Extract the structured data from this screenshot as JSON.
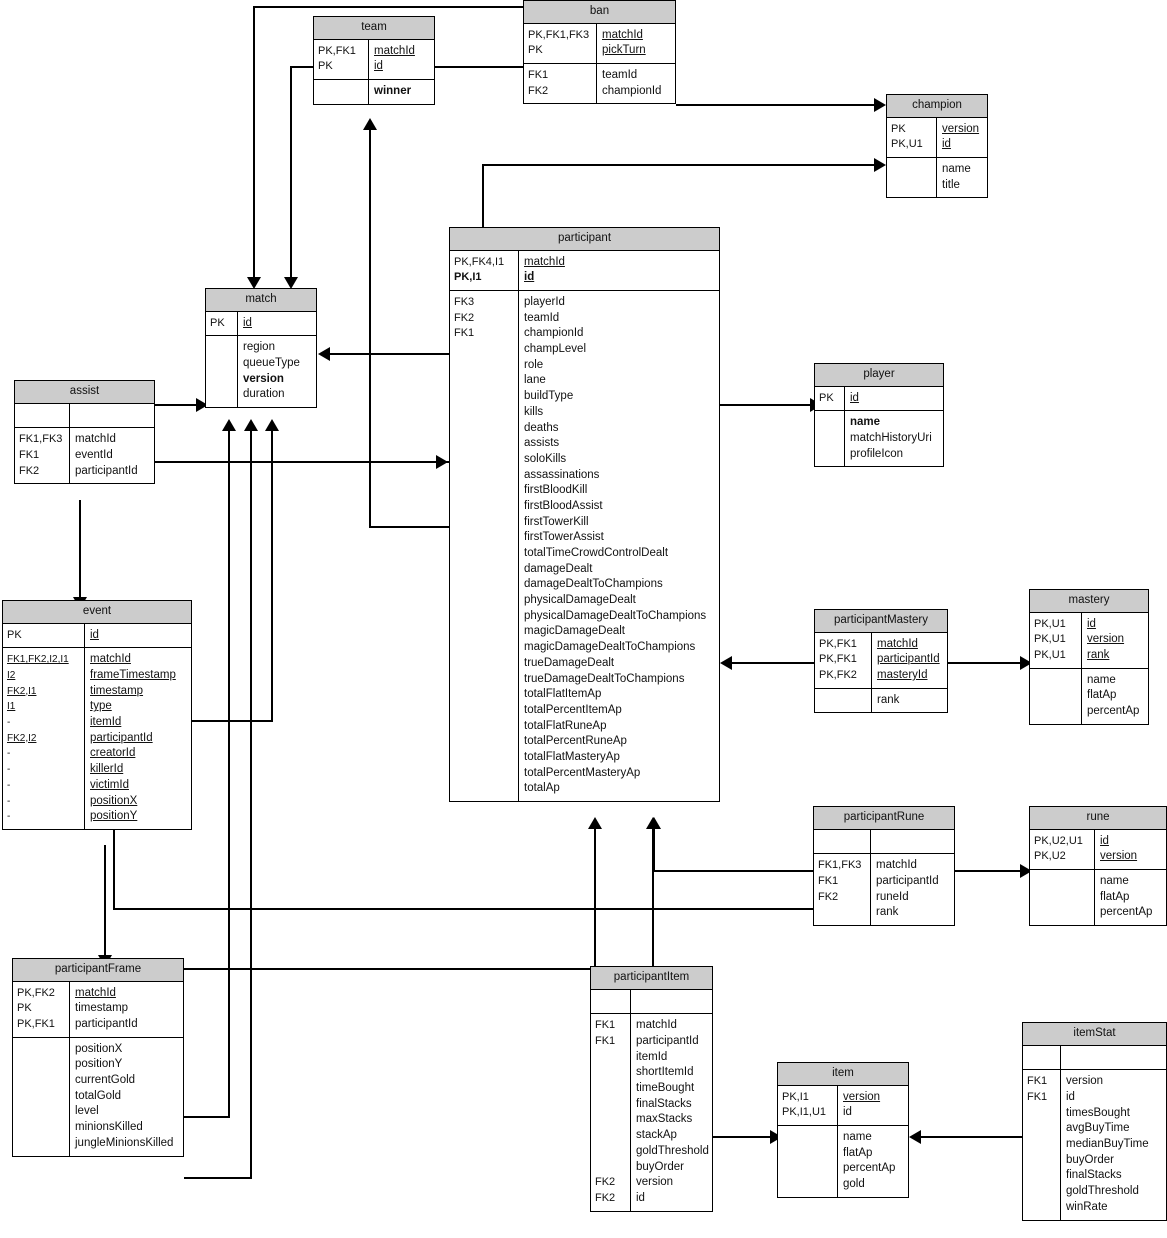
{
  "diagram": {
    "title": "League of Legends match database ER diagram",
    "header_fill": "#cccccc",
    "line_color": "#000000",
    "background": "#ffffff"
  },
  "entities": {
    "team": {
      "name": "team",
      "pk": {
        "keys": [
          "PK,FK1",
          "PK"
        ],
        "attrs": [
          "matchId",
          "id"
        ],
        "underline": [
          true,
          true
        ],
        "bold": [
          false,
          false
        ]
      },
      "attrs": {
        "keys": [
          ""
        ],
        "attrs": [
          "winner"
        ],
        "underline": [
          false
        ],
        "bold": [
          true
        ]
      }
    },
    "ban": {
      "name": "ban",
      "pk": {
        "keys": [
          "PK,FK1,FK3",
          "PK"
        ],
        "attrs": [
          "matchId",
          "pickTurn"
        ],
        "underline": [
          true,
          true
        ],
        "bold": [
          false,
          false
        ]
      },
      "attrs": {
        "keys": [
          "FK1",
          "FK2"
        ],
        "attrs": [
          "teamId",
          "championId"
        ],
        "underline": [
          false,
          false
        ],
        "bold": [
          false,
          false
        ]
      }
    },
    "champion": {
      "name": "champion",
      "pk": {
        "keys": [
          "PK",
          "PK,U1"
        ],
        "attrs": [
          "version",
          "id"
        ],
        "underline": [
          true,
          true
        ],
        "bold": [
          false,
          false
        ]
      },
      "attrs": {
        "keys": [
          "",
          ""
        ],
        "attrs": [
          "name",
          "title"
        ],
        "underline": [
          false,
          false
        ],
        "bold": [
          false,
          false
        ]
      }
    },
    "match": {
      "name": "match",
      "pk": {
        "keys": [
          "PK"
        ],
        "attrs": [
          "id"
        ],
        "underline": [
          true
        ],
        "bold": [
          false
        ]
      },
      "attrs": {
        "keys": [
          "",
          "",
          "",
          ""
        ],
        "attrs": [
          "region",
          "queueType",
          "version",
          "duration"
        ],
        "underline": [
          false,
          false,
          false,
          false
        ],
        "bold": [
          false,
          false,
          true,
          false
        ]
      }
    },
    "participant": {
      "name": "participant",
      "pk": {
        "keys": [
          "PK,FK4,I1",
          "PK,I1"
        ],
        "attrs": [
          "matchId",
          "id"
        ],
        "underline": [
          true,
          true
        ],
        "bold": [
          false,
          true
        ]
      },
      "attrs": {
        "keys": [
          "FK3",
          "FK2",
          "FK1",
          "",
          "",
          "",
          "",
          "",
          "",
          "",
          "",
          "",
          "",
          "",
          "",
          "",
          "",
          "",
          "",
          "",
          "",
          "",
          "",
          "",
          "",
          "",
          "",
          "",
          "",
          "",
          "",
          ""
        ],
        "attrs": [
          "playerId",
          "teamId",
          "championId",
          "champLevel",
          "role",
          "lane",
          "buildType",
          "kills",
          "deaths",
          "assists",
          "soloKills",
          "assassinations",
          "firstBloodKill",
          "firstBloodAssist",
          "firstTowerKill",
          "firstTowerAssist",
          "totalTimeCrowdControlDealt",
          "damageDealt",
          "damageDealtToChampions",
          "physicalDamageDealt",
          "physicalDamageDealtToChampions",
          "magicDamageDealt",
          "magicDamageDealtToChampions",
          "trueDamageDealt",
          "trueDamageDealtToChampions",
          "totalFlatItemAp",
          "totalPercentItemAp",
          "totalFlatRuneAp",
          "totalPercentRuneAp",
          "totalFlatMasteryAp",
          "totalPercentMasteryAp",
          "totalAp"
        ]
      }
    },
    "player": {
      "name": "player",
      "pk": {
        "keys": [
          "PK"
        ],
        "attrs": [
          "id"
        ],
        "underline": [
          true
        ],
        "bold": [
          false
        ]
      },
      "attrs": {
        "keys": [
          "",
          "",
          ""
        ],
        "attrs": [
          "name",
          "matchHistoryUri",
          "profileIcon"
        ],
        "underline": [
          false,
          false,
          false
        ],
        "bold": [
          true,
          false,
          false
        ]
      }
    },
    "assist": {
      "name": "assist",
      "pk": {
        "keys": [
          ""
        ],
        "attrs": [
          ""
        ],
        "underline": [
          false
        ],
        "bold": [
          false
        ]
      },
      "attrs": {
        "keys": [
          "FK1,FK3",
          "FK1",
          "FK2"
        ],
        "attrs": [
          "matchId",
          "eventId",
          "participantId"
        ],
        "underline": [
          false,
          false,
          false
        ],
        "bold": [
          false,
          false,
          false
        ]
      }
    },
    "event": {
      "name": "event",
      "pk": {
        "keys": [
          "PK"
        ],
        "attrs": [
          "id"
        ],
        "underline": [
          true
        ],
        "bold": [
          false
        ]
      },
      "attrs": {
        "keys": [
          "FK1,FK2,I2,I1",
          "I2",
          "FK2,I1",
          "I1",
          "-",
          "FK2,I2",
          "-",
          "-",
          "-",
          "-",
          "-"
        ],
        "attrs": [
          "matchId",
          "frameTimestamp",
          "timestamp",
          "type",
          "itemId",
          "participantId",
          "creatorId",
          "killerId",
          "victimId",
          "positionX",
          "positionY"
        ],
        "key_underline": [
          true,
          true,
          true,
          true,
          false,
          true,
          false,
          false,
          false,
          false,
          false
        ],
        "underline": [
          true,
          true,
          true,
          true,
          true,
          true,
          true,
          true,
          true,
          true,
          true
        ]
      }
    },
    "participantMastery": {
      "name": "participantMastery",
      "pk": {
        "keys": [
          "PK,FK1",
          "PK,FK1",
          "PK,FK2"
        ],
        "attrs": [
          "matchId",
          "participantId",
          "masteryId"
        ],
        "underline": [
          true,
          true,
          true
        ],
        "bold": [
          false,
          false,
          false
        ]
      },
      "attrs": {
        "keys": [
          ""
        ],
        "attrs": [
          "rank"
        ],
        "underline": [
          false
        ],
        "bold": [
          false
        ]
      }
    },
    "mastery": {
      "name": "mastery",
      "pk": {
        "keys": [
          "PK,U1",
          "PK,U1",
          "PK,U1"
        ],
        "attrs": [
          "id",
          "version",
          "rank"
        ],
        "underline": [
          true,
          true,
          true
        ],
        "bold": [
          false,
          false,
          false
        ]
      },
      "attrs": {
        "keys": [
          "",
          "",
          ""
        ],
        "attrs": [
          "name",
          "flatAp",
          "percentAp"
        ],
        "underline": [
          false,
          false,
          false
        ],
        "bold": [
          false,
          false,
          false
        ]
      }
    },
    "participantRune": {
      "name": "participantRune",
      "pk": {
        "keys": [
          ""
        ],
        "attrs": [
          ""
        ],
        "underline": [
          false
        ],
        "bold": [
          false
        ]
      },
      "attrs": {
        "keys": [
          "FK1,FK3",
          "FK1",
          "FK2",
          ""
        ],
        "attrs": [
          "matchId",
          "participantId",
          "runeId",
          "rank"
        ],
        "underline": [
          false,
          false,
          false,
          false
        ],
        "bold": [
          false,
          false,
          false,
          false
        ]
      }
    },
    "rune": {
      "name": "rune",
      "pk": {
        "keys": [
          "PK,U2,U1",
          "PK,U2"
        ],
        "attrs": [
          "id",
          "version"
        ],
        "underline": [
          true,
          true
        ],
        "bold": [
          false,
          false
        ]
      },
      "attrs": {
        "keys": [
          "",
          "",
          ""
        ],
        "attrs": [
          "name",
          "flatAp",
          "percentAp"
        ],
        "underline": [
          false,
          false,
          false
        ],
        "bold": [
          false,
          false,
          false
        ]
      }
    },
    "participantFrame": {
      "name": "participantFrame",
      "pk": {
        "keys": [
          "PK,FK2",
          "PK",
          "PK,FK1"
        ],
        "attrs": [
          "matchId",
          "timestamp",
          "participantId"
        ],
        "underline": [
          true,
          false,
          false
        ],
        "bold": [
          false,
          false,
          false
        ]
      },
      "attrs": {
        "keys": [
          "",
          "",
          "",
          "",
          "",
          "",
          ""
        ],
        "attrs": [
          "positionX",
          "positionY",
          "currentGold",
          "totalGold",
          "level",
          "minionsKilled",
          "jungleMinionsKilled"
        ],
        "underline": [
          false,
          false,
          false,
          false,
          false,
          false,
          false
        ],
        "bold": [
          false,
          false,
          false,
          false,
          false,
          false,
          false
        ]
      }
    },
    "participantItem": {
      "name": "participantItem",
      "pk": {
        "keys": [
          ""
        ],
        "attrs": [
          ""
        ],
        "underline": [
          false
        ],
        "bold": [
          false
        ]
      },
      "attrs": {
        "keys": [
          "FK1",
          "FK1",
          "",
          "",
          "",
          "",
          "",
          "",
          "",
          "",
          "FK2",
          "FK2"
        ],
        "attrs": [
          "matchId",
          "participantId",
          "itemId",
          "shortItemId",
          "timeBought",
          "finalStacks",
          "maxStacks",
          "stackAp",
          "goldThreshold",
          "buyOrder",
          "version",
          "id"
        ],
        "underline": [
          false,
          false,
          false,
          false,
          false,
          false,
          false,
          false,
          false,
          false,
          false,
          false
        ],
        "bold": [
          false,
          false,
          false,
          false,
          false,
          false,
          false,
          false,
          false,
          false,
          false,
          false
        ]
      }
    },
    "item": {
      "name": "item",
      "pk": {
        "keys": [
          "PK,I1",
          "PK,I1,U1"
        ],
        "attrs": [
          "version",
          "id"
        ],
        "underline": [
          true,
          false
        ],
        "bold": [
          false,
          false
        ]
      },
      "attrs": {
        "keys": [
          "",
          "",
          "",
          ""
        ],
        "attrs": [
          "name",
          "flatAp",
          "percentAp",
          "gold"
        ],
        "underline": [
          false,
          false,
          false,
          false
        ],
        "bold": [
          false,
          false,
          false,
          false
        ]
      }
    },
    "itemStat": {
      "name": "itemStat",
      "pk": {
        "keys": [
          ""
        ],
        "attrs": [
          ""
        ],
        "underline": [
          false
        ],
        "bold": [
          false
        ]
      },
      "attrs": {
        "keys": [
          "FK1",
          "FK1",
          "",
          "",
          "",
          "",
          "",
          "",
          ""
        ],
        "attrs": [
          "version",
          "id",
          "timesBought",
          "avgBuyTime",
          "medianBuyTime",
          "buyOrder",
          "finalStacks",
          "goldThreshold",
          "winRate"
        ],
        "underline": [
          false,
          false,
          false,
          false,
          false,
          false,
          false,
          false,
          false
        ],
        "bold": [
          false,
          false,
          false,
          false,
          false,
          false,
          false,
          false,
          false
        ]
      }
    }
  },
  "relationships": [
    {
      "from": "ban",
      "to": "team",
      "label": "ban-to-team"
    },
    {
      "from": "ban",
      "to": "match",
      "label": "ban-to-match"
    },
    {
      "from": "ban",
      "to": "champion",
      "label": "ban-to-champion"
    },
    {
      "from": "team",
      "to": "match",
      "label": "team-to-match"
    },
    {
      "from": "participant",
      "to": "team",
      "label": "participant-to-team"
    },
    {
      "from": "participant",
      "to": "match",
      "label": "participant-to-match"
    },
    {
      "from": "participant",
      "to": "champion",
      "label": "participant-to-champion"
    },
    {
      "from": "participant",
      "to": "player",
      "label": "participant-to-player"
    },
    {
      "from": "assist",
      "to": "match",
      "label": "assist-to-match"
    },
    {
      "from": "assist",
      "to": "participant",
      "label": "assist-to-participant"
    },
    {
      "from": "assist",
      "to": "event",
      "label": "assist-to-event"
    },
    {
      "from": "event",
      "to": "match",
      "label": "event-to-match"
    },
    {
      "from": "event",
      "to": "participantFrame",
      "label": "event-to-participantframe"
    },
    {
      "from": "participantMastery",
      "to": "participant",
      "label": "participantmastery-to-participant"
    },
    {
      "from": "participantMastery",
      "to": "mastery",
      "label": "participantmastery-to-mastery"
    },
    {
      "from": "participantRune",
      "to": "participant",
      "label": "participantrune-to-participant"
    },
    {
      "from": "participantRune",
      "to": "rune",
      "label": "participantrune-to-rune"
    },
    {
      "from": "participantFrame",
      "to": "match",
      "label": "participantframe-to-match"
    },
    {
      "from": "participantFrame",
      "to": "participant",
      "label": "participantframe-to-participant"
    },
    {
      "from": "participantItem",
      "to": "participant",
      "label": "participantitem-to-participant"
    },
    {
      "from": "participantItem",
      "to": "item",
      "label": "participantitem-to-item"
    },
    {
      "from": "itemStat",
      "to": "item",
      "label": "itemstat-to-item"
    }
  ]
}
